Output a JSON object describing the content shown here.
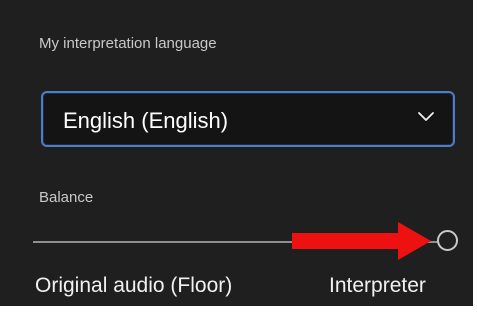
{
  "language_section": {
    "label": "My interpretation language",
    "dropdown": {
      "selected_value": "English (English)",
      "icon": "chevron-down-icon"
    }
  },
  "balance_section": {
    "label": "Balance",
    "slider": {
      "value_percent": 100,
      "min_label": "Original audio (Floor)",
      "max_label": "Interpreter"
    }
  },
  "annotation": {
    "type": "arrow",
    "color": "#ee1111"
  },
  "colors": {
    "panel_background": "#1f1f1f",
    "dropdown_border": "#4f7cc2",
    "text_primary": "#f1f1f1",
    "text_secondary": "#c9c9c9"
  }
}
